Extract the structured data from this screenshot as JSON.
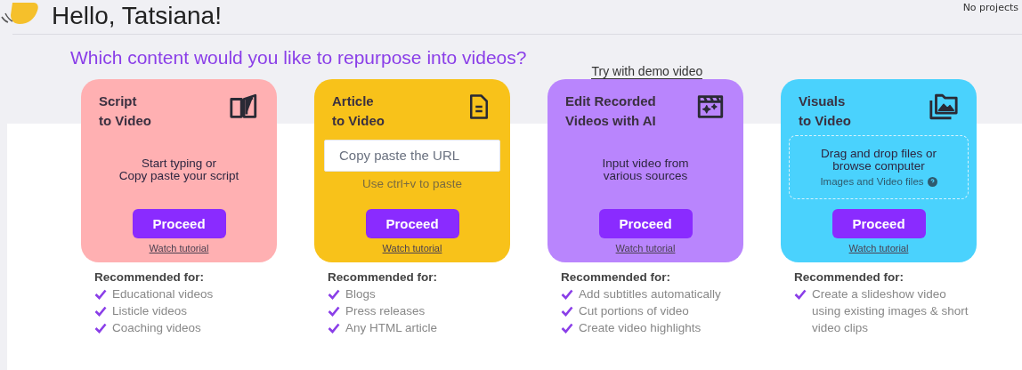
{
  "greeting": "Hello, Tatsiana!",
  "projects_note": "No projects",
  "question": "Which content would you like to repurpose into videos?",
  "demo_link": "Try with demo video",
  "cards": [
    {
      "kind": "text",
      "title_1": "Script",
      "title_2": "to Video",
      "color": "#ffb0b2",
      "body": [
        "Start typing or",
        "Copy paste your script"
      ],
      "button": "Proceed",
      "tutorial": "Watch tutorial",
      "recommended_title": "Recommended for:",
      "recommended": [
        "Educational videos",
        "Listicle videos",
        "Coaching videos"
      ]
    },
    {
      "kind": "url",
      "title_1": "Article",
      "title_2": "to Video",
      "color": "#f8c21a",
      "placeholder": "Copy paste the URL",
      "hint": "Use ctrl+v to paste",
      "button": "Proceed",
      "tutorial": "Watch tutorial",
      "recommended_title": "Recommended for:",
      "recommended": [
        "Blogs",
        "Press releases",
        "Any HTML article"
      ]
    },
    {
      "kind": "text",
      "title_1": "Edit Recorded",
      "title_2": "Videos with AI",
      "color": "#b985fd",
      "body": [
        "Input video from",
        "various sources"
      ],
      "button": "Proceed",
      "tutorial": "Watch tutorial",
      "recommended_title": "Recommended for:",
      "recommended": [
        "Add subtitles automatically",
        "Cut portions of video",
        "Create video highlights"
      ]
    },
    {
      "kind": "drop",
      "title_1": "Visuals",
      "title_2": "to Video",
      "color": "#4ad2fd",
      "body": [
        "Drag and drop files or",
        "browse computer"
      ],
      "hint": "Images and Video files",
      "button": "Proceed",
      "tutorial": "Watch tutorial",
      "recommended_title": "Recommended for:",
      "recommended": [
        "Create a slideshow video using existing images & short video clips"
      ]
    }
  ]
}
